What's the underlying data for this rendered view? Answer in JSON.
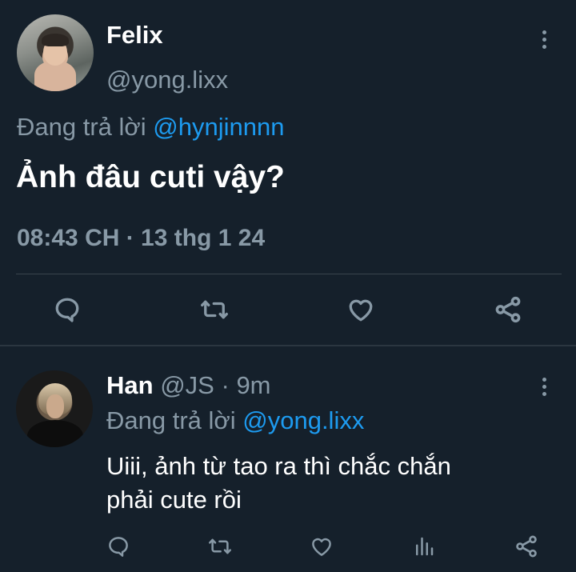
{
  "main_tweet": {
    "display_name": "Felix",
    "handle": "@yong.lixx",
    "reply_prefix": "Đang trả lời",
    "reply_to": "@hynjinnnn",
    "text": "Ảnh đâu cuti vậy?",
    "timestamp": "08:43 CH · 13 thg 1 24",
    "actions": [
      "reply-icon",
      "retweet-icon",
      "like-icon",
      "share-icon"
    ]
  },
  "reply_tweet": {
    "display_name": "Han",
    "handle": "@JS",
    "separator": "·",
    "time": "9m",
    "reply_prefix": "Đang trả lời",
    "reply_to": "@yong.lixx",
    "text_line1": "Uiii, ảnh từ tao ra thì chắc chắn",
    "text_line2": "phải cute rồi",
    "actions": [
      "reply-icon",
      "retweet-icon",
      "like-icon",
      "analytics-icon",
      "share-icon"
    ]
  },
  "colors": {
    "background": "#15202b",
    "text_primary": "#ffffff",
    "text_secondary": "#8899a6",
    "mention": "#1d9bf0",
    "divider": "#38444d"
  }
}
